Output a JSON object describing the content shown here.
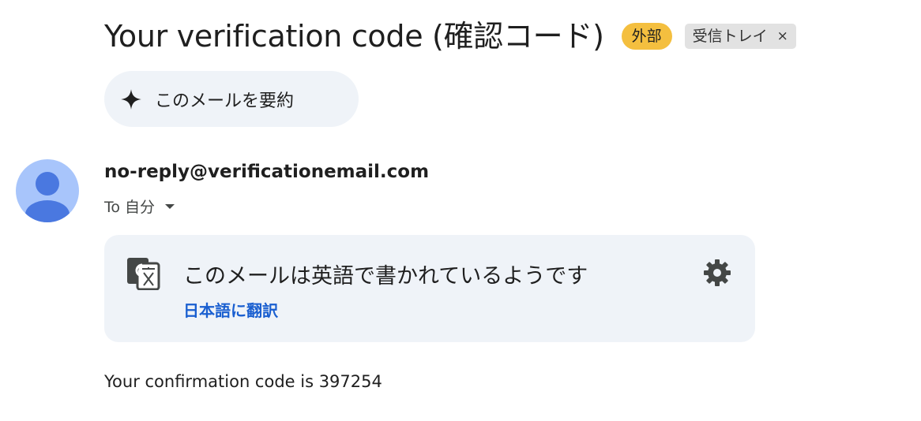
{
  "subject": "Your verification code (確認コード)",
  "labels": {
    "external": "外部",
    "inbox": "受信トレイ",
    "remove_glyph": "×"
  },
  "summary_button": {
    "label": "このメールを要約",
    "icon": "sparkle-icon"
  },
  "sender": {
    "email": "no-reply@verificationemail.com",
    "to_label": "To 自分",
    "avatar_icon": "person-icon"
  },
  "translation_bar": {
    "message": "このメールは英語で書かれているようです",
    "translate_link": "日本語に翻訳",
    "icons": [
      "translate-icon",
      "gear-icon"
    ]
  },
  "body": {
    "text": "Your confirmation code is 397254"
  },
  "colors": {
    "external_badge": "#f4bf3f",
    "inbox_badge": "#e2e2e2",
    "panel_bg": "#eff3f8",
    "link": "#1a5fd0",
    "avatar_bg": "#a8c5fb",
    "avatar_fg": "#4a78e0"
  }
}
